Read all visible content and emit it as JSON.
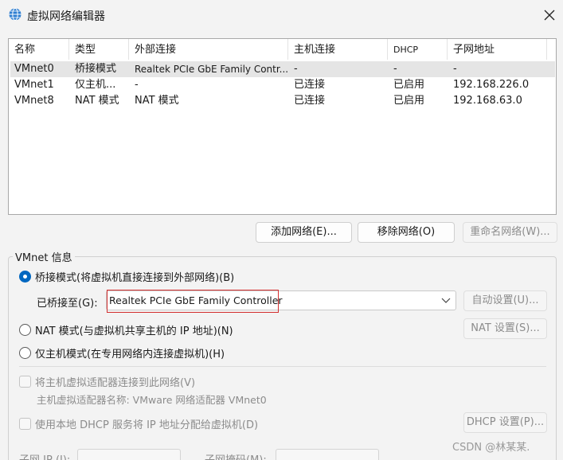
{
  "window": {
    "title": "虚拟网络编辑器",
    "app_icon": "globe-network-icon",
    "close_icon": "close-icon"
  },
  "table": {
    "columns": [
      "名称",
      "类型",
      "外部连接",
      "主机连接",
      "DHCP",
      "子网地址"
    ],
    "rows": [
      {
        "name": "VMnet0",
        "type": "桥接模式",
        "external": "Realtek PCIe GbE Family Contr...",
        "host": "-",
        "dhcp": "-",
        "subnet": "-",
        "selected": true
      },
      {
        "name": "VMnet1",
        "type": "仅主机...",
        "external": "-",
        "host": "已连接",
        "dhcp": "已启用",
        "subnet": "192.168.226.0",
        "selected": false
      },
      {
        "name": "VMnet8",
        "type": "NAT 模式",
        "external": "NAT 模式",
        "host": "已连接",
        "dhcp": "已启用",
        "subnet": "192.168.63.0",
        "selected": false
      }
    ]
  },
  "buttons": {
    "add_network": "添加网络(E)...",
    "remove_network": "移除网络(O)",
    "rename_network": "重命名网络(W)..."
  },
  "vmnet_info": {
    "group_title": "VMnet 信息",
    "bridged_radio": "桥接模式(将虚拟机直接连接到外部网络)(B)",
    "bridged_to_label": "已桥接至(G):",
    "bridged_to_value": "Realtek PCIe GbE Family Controller",
    "auto_settings": "自动设置(U)...",
    "nat_radio": "NAT 模式(与虚拟机共享主机的 IP 地址)(N)",
    "nat_settings": "NAT 设置(S)...",
    "hostonly_radio": "仅主机模式(在专用网络内连接虚拟机)(H)",
    "connect_adapter_check": "将主机虚拟适配器连接到此网络(V)",
    "adapter_name": "主机虚拟适配器名称: VMware 网络适配器 VMnet0",
    "dhcp_check": "使用本地 DHCP 服务将 IP 地址分配给虚拟机(D)",
    "dhcp_settings": "DHCP 设置(P)...",
    "subnet_ip_label": "子网 IP (I):",
    "subnet_mask_label": "子网掩码(M):",
    "selected_mode": "bridged"
  },
  "watermark": "CSDN @林某某.",
  "colors": {
    "accent": "#0067c0",
    "highlight_box": "#d32f2f",
    "selected_row": "#e5e5e5"
  }
}
